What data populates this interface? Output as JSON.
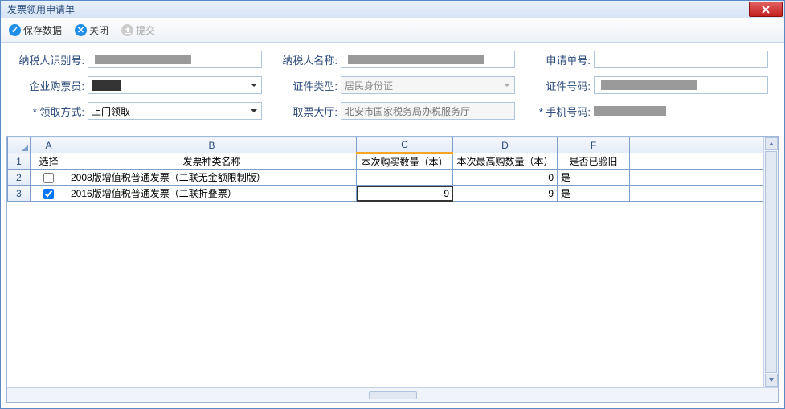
{
  "window": {
    "title": "发票领用申请单"
  },
  "toolbar": {
    "save_label": "保存数据",
    "close_label": "关闭",
    "submit_label": "提交"
  },
  "form": {
    "taxpayer_id_label": "纳税人识别号:",
    "taxpayer_name_label": "纳税人名称:",
    "request_no_label": "申请单号:",
    "buyer_label": "企业购票员:",
    "cert_type_label": "证件类型:",
    "cert_type_value": "居民身份证",
    "cert_no_label": "证件号码:",
    "pickup_method_label": "* 领取方式:",
    "pickup_method_value": "上门领取",
    "pickup_hall_label": "取票大厅:",
    "pickup_hall_value": "北安市国家税务局办税服务厅",
    "phone_label": "* 手机号码:"
  },
  "sheet": {
    "col_letters": {
      "A": "A",
      "B": "B",
      "C": "C",
      "D": "D",
      "F": "F"
    },
    "headers": {
      "select": "选择",
      "invoice_type_name": "发票种类名称",
      "buy_qty": "本次购买数量（本）",
      "max_qty": "本次最高购数量（本）",
      "verified_old": "是否已验旧"
    },
    "rows": [
      {
        "rownum": "2",
        "selected": false,
        "invoice_type_name": "2008版增值税普通发票（二联无金额限制版）",
        "buy_qty": "",
        "max_qty": "0",
        "verified_old": "是"
      },
      {
        "rownum": "3",
        "selected": true,
        "invoice_type_name": "2016版增值税普通发票（二联折叠票）",
        "buy_qty": "9",
        "max_qty": "9",
        "verified_old": "是"
      }
    ],
    "header_rownum": "1"
  }
}
